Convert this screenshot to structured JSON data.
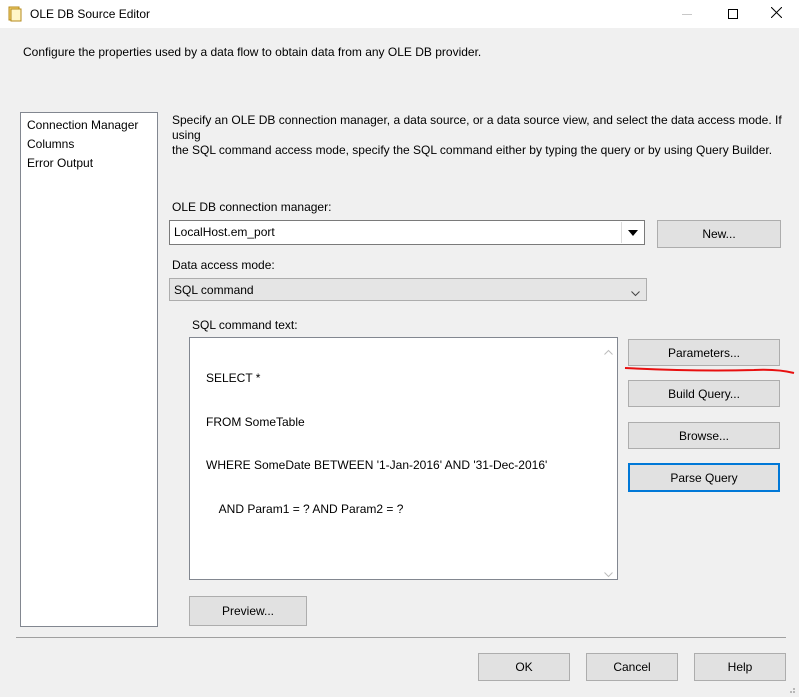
{
  "window": {
    "title": "OLE DB Source Editor",
    "icon": "folder-document-icon",
    "controls": {
      "minimize": "—",
      "maximize": "☐",
      "close": "✕"
    }
  },
  "header": {
    "description": "Configure the properties used by a data flow to obtain data from any OLE DB provider."
  },
  "nav": {
    "items": [
      {
        "label": "Connection Manager"
      },
      {
        "label": "Columns"
      },
      {
        "label": "Error Output"
      }
    ]
  },
  "main": {
    "intro_line1": "Specify an OLE DB connection manager, a data source, or a data source view, and select the data access mode. If using",
    "intro_line2": "the SQL command access mode, specify the SQL command either by typing the query or by using Query Builder.",
    "connection_manager_label": "OLE DB connection manager:",
    "connection_manager_value": "LocalHost.em_port",
    "new_button": "New...",
    "access_mode_label": "Data access mode:",
    "access_mode_value": "SQL command",
    "sql_label": "SQL command text:",
    "sql_lines": [
      "SELECT *",
      "FROM SomeTable",
      "WHERE SomeDate BETWEEN '1-Jan-2016' AND '31-Dec-2016'",
      "    AND Param1 = ? AND Param2 = ?"
    ],
    "parameters_button": "Parameters...",
    "build_query_button": "Build Query...",
    "browse_button": "Browse...",
    "parse_query_button": "Parse Query",
    "preview_button": "Preview..."
  },
  "footer": {
    "ok": "OK",
    "cancel": "Cancel",
    "help": "Help"
  },
  "colors": {
    "annotation_red": "#e81010",
    "focus_blue": "#0078d7",
    "button_face": "#e1e1e1"
  }
}
